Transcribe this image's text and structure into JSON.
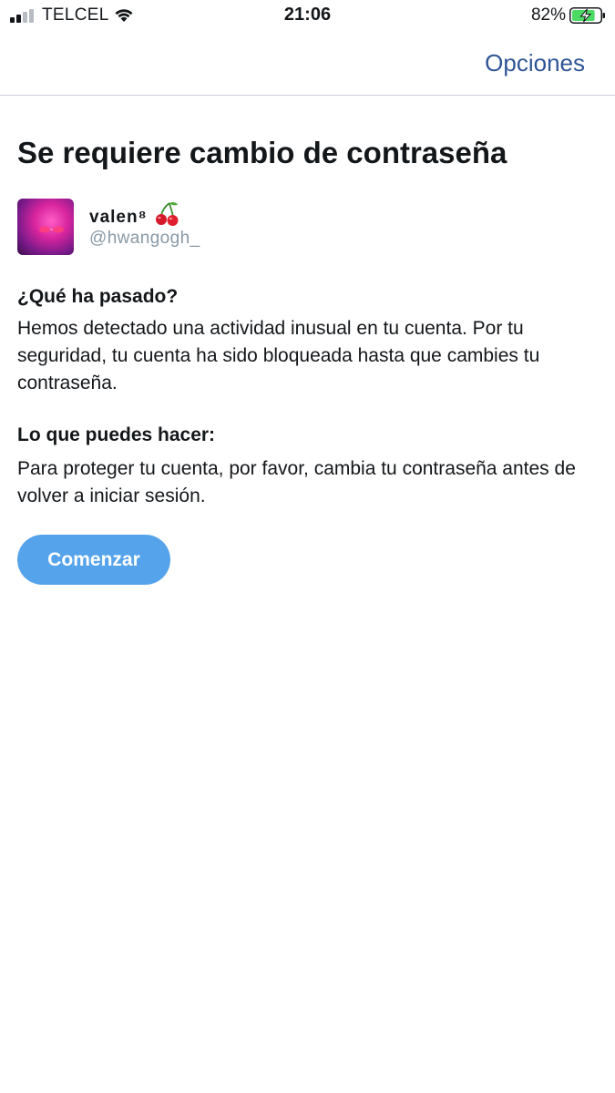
{
  "status_bar": {
    "carrier": "TELCEL",
    "time": "21:06",
    "battery_percent": "82%",
    "signal_bars_active": 2,
    "signal_bars_total": 4,
    "battery_level": 0.82,
    "charging": true
  },
  "navbar": {
    "options_label": "Opciones"
  },
  "page": {
    "title": "Se requiere cambio de contraseña"
  },
  "profile": {
    "display_name": "valen⁸",
    "emoji_icon": "cherry-icon",
    "handle": "@hwangogh_"
  },
  "sections": {
    "what_happened": {
      "heading": "¿Qué ha pasado?",
      "body": "Hemos detectado una actividad inusual en tu cuenta. Por tu seguridad, tu cuenta ha sido bloqueada hasta que cambies tu contraseña."
    },
    "what_you_can_do": {
      "heading": "Lo que puedes hacer:",
      "body": "Para proteger tu cuenta, por favor, cambia tu contraseña antes de volver a iniciar sesión."
    }
  },
  "actions": {
    "start_label": "Comenzar"
  },
  "colors": {
    "accent_link": "#2f5596",
    "button": "#55a3ea",
    "muted_text": "#8899a6",
    "battery_fill": "#4cd964"
  }
}
